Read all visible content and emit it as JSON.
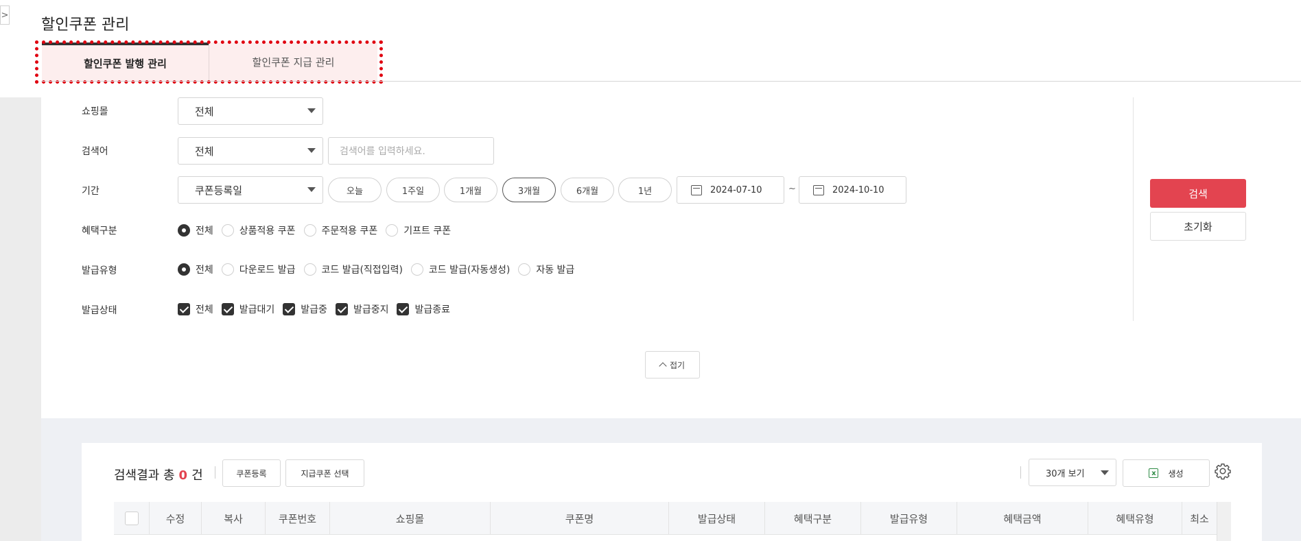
{
  "page": {
    "title": "할인쿠폰 관리",
    "expand_glyph": ">"
  },
  "tabs": [
    {
      "label": "할인쿠폰 발행 관리"
    },
    {
      "label": "할인쿠폰 지급 관리"
    }
  ],
  "form": {
    "mall": {
      "label": "쇼핑몰",
      "value": "전체"
    },
    "keyword": {
      "label": "검색어",
      "value": "전체",
      "placeholder": "검색어를 입력하세요."
    },
    "period": {
      "label": "기간",
      "date_type": "쿠폰등록일",
      "buttons": [
        "오늘",
        "1주일",
        "1개월",
        "3개월",
        "6개월",
        "1년"
      ],
      "selected": "3개월",
      "start_date": "2024-07-10",
      "end_date": "2024-10-10",
      "separator": "~"
    },
    "benefit": {
      "label": "혜택구분",
      "options": [
        "전체",
        "상품적용 쿠폰",
        "주문적용 쿠폰",
        "기프트 쿠폰"
      ],
      "selected": "전체"
    },
    "issue_type": {
      "label": "발급유형",
      "options": [
        "전체",
        "다운로드 발급",
        "코드 발급(직접입력)",
        "코드 발급(자동생성)",
        "자동 발급"
      ],
      "selected": "전체"
    },
    "issue_status": {
      "label": "발급상태",
      "options": [
        "전체",
        "발급대기",
        "발급중",
        "발급중지",
        "발급종료"
      ]
    },
    "search_button": "검색",
    "reset_button": "초기화",
    "fold_button": "접기"
  },
  "results": {
    "prefix": "검색결과 총",
    "count": "0",
    "suffix": "건",
    "register_button": "쿠폰등록",
    "select_button": "지급쿠폰 선택",
    "view_select": "30개 보기",
    "excel_button": "생성",
    "columns": [
      "수정",
      "복사",
      "쿠폰번호",
      "쇼핑몰",
      "쿠폰명",
      "발급상태",
      "혜택구분",
      "발급유형",
      "혜택금액",
      "혜택유형",
      "최소"
    ]
  },
  "colors": {
    "accent": "#e34450",
    "tab_highlight": "#fdeeee",
    "dotted_outline": "#e00010"
  }
}
